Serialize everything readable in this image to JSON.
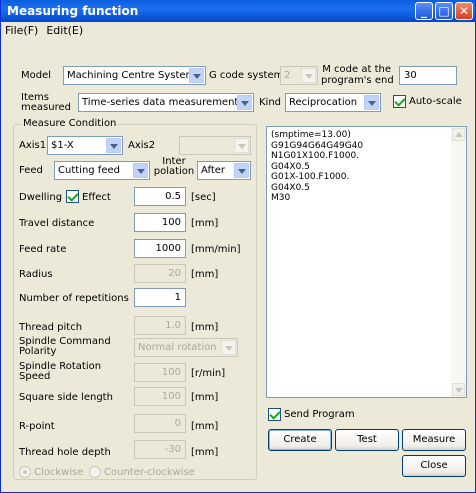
{
  "window": {
    "title": "Measuring function"
  },
  "menu": {
    "file": "File(F)",
    "edit": "Edit(E)"
  },
  "top": {
    "model_label": "Model",
    "model_value": "Machining Centre System",
    "gcode_label": "G code system",
    "gcode_value": "2",
    "mcode_label_1": "M code at the",
    "mcode_label_2": "program's end",
    "mcode_value": "30",
    "items_label_1": "Items",
    "items_label_2": "measured",
    "items_value": "Time-series data measurement",
    "kind_label": "Kind",
    "kind_value": "Reciprocation",
    "autoscale_label": "Auto-scale"
  },
  "condition": {
    "group_title": "Measure Condition",
    "axis1_label": "Axis1",
    "axis1_value": "$1-X",
    "axis2_label": "Axis2",
    "feed_label": "Feed",
    "feed_value": "Cutting feed",
    "inter_label_1": "Inter",
    "inter_label_2": "polation",
    "inter_value": "After",
    "dwelling_label": "Dwelling",
    "effect_label": "Effect",
    "dwelling_value": "0.5",
    "dwelling_unit": "[sec]",
    "travel_label": "Travel distance",
    "travel_value": "100",
    "travel_unit": "[mm]",
    "feedrate_label": "Feed rate",
    "feedrate_value": "1000",
    "feedrate_unit": "[mm/min]",
    "radius_label": "Radius",
    "radius_value": "20",
    "radius_unit": "[mm]",
    "reps_label": "Number of repetitions",
    "reps_value": "1",
    "pitch_label": "Thread pitch",
    "pitch_value": "1.0",
    "pitch_unit": "[mm]",
    "spindle_pol_label_1": "Spindle Command",
    "spindle_pol_label_2": "Polarity",
    "spindle_pol_value": "Normal rotation",
    "spindle_speed_label_1": "Spindle Rotation",
    "spindle_speed_label_2": "Speed",
    "spindle_speed_value": "100",
    "spindle_speed_unit": "[r/min]",
    "square_label": "Square side length",
    "square_value": "100",
    "square_unit": "[mm]",
    "rpoint_label": "R-point",
    "rpoint_value": "0",
    "rpoint_unit": "[mm]",
    "hole_label": "Thread hole depth",
    "hole_value": "-30",
    "hole_unit": "[mm]",
    "cw_label": "Clockwise",
    "ccw_label": "Counter-clockwise"
  },
  "program": {
    "lines": [
      "(smptime=13.00)",
      "G91G94G64G49G40",
      "N1G01X100.F1000.",
      "G04X0.5",
      "G01X-100.F1000.",
      "G04X0.5",
      "M30"
    ]
  },
  "actions": {
    "send_program_label": "Send Program",
    "create": "Create",
    "test": "Test",
    "measure": "Measure",
    "close": "Close"
  }
}
